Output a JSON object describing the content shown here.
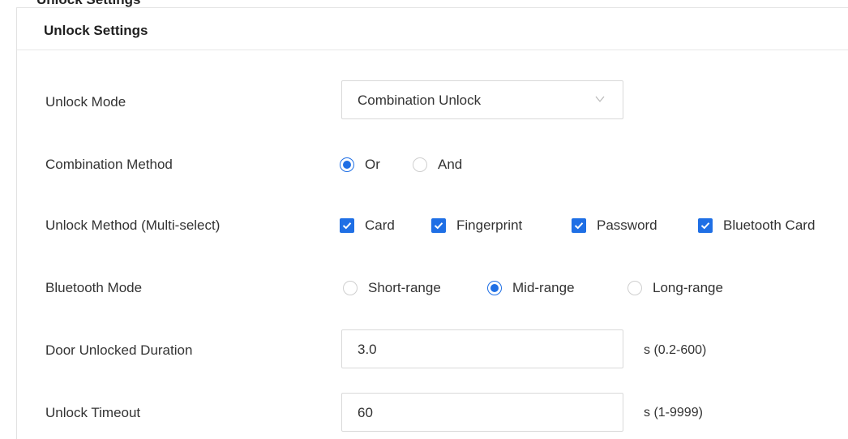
{
  "clipped_heading": "Unlock Settings",
  "panel": {
    "title": "Unlock Settings"
  },
  "unlock_mode": {
    "label": "Unlock Mode",
    "value": "Combination Unlock"
  },
  "combination_method": {
    "label": "Combination Method",
    "options": [
      {
        "label": "Or",
        "selected": true
      },
      {
        "label": "And",
        "selected": false
      }
    ]
  },
  "unlock_method": {
    "label": "Unlock Method (Multi-select)",
    "options": [
      {
        "label": "Card",
        "checked": true
      },
      {
        "label": "Fingerprint",
        "checked": true
      },
      {
        "label": "Password",
        "checked": true
      },
      {
        "label": "Bluetooth Card",
        "checked": true
      }
    ]
  },
  "bluetooth_mode": {
    "label": "Bluetooth Mode",
    "options": [
      {
        "label": "Short-range",
        "selected": false
      },
      {
        "label": "Mid-range",
        "selected": true
      },
      {
        "label": "Long-range",
        "selected": false
      }
    ]
  },
  "door_unlocked_duration": {
    "label": "Door Unlocked Duration",
    "value": "3.0",
    "unit": "s (0.2-600)"
  },
  "unlock_timeout": {
    "label": "Unlock Timeout",
    "value": "60",
    "unit": "s (1-9999)"
  },
  "colors": {
    "accent": "#1f6fe5",
    "border": "#d9d9d9",
    "text": "#333333"
  }
}
